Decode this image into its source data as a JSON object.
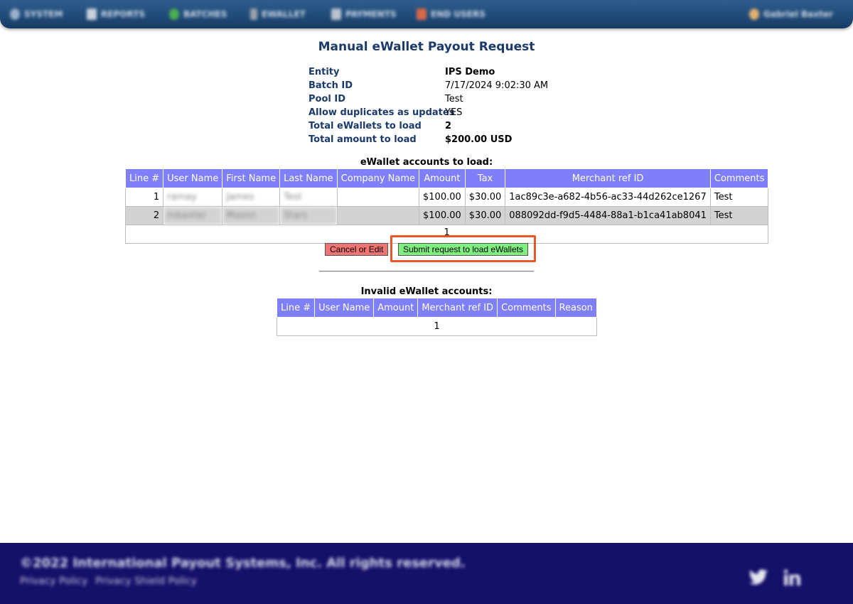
{
  "nav": {
    "items": [
      {
        "label": "SYSTEM",
        "icon": "gear-icon",
        "color": "#9ab0c8"
      },
      {
        "label": "REPORTS",
        "icon": "document-icon",
        "color": "#c8d2dc"
      },
      {
        "label": "BATCHES",
        "icon": "batches-icon",
        "color": "#4caf50"
      },
      {
        "label": "EWALLET",
        "icon": "wallet-icon",
        "color": "#9aa3ad"
      },
      {
        "label": "PAYMENTS",
        "icon": "payments-icon",
        "color": "#b9c3cf"
      },
      {
        "label": "END USERS",
        "icon": "users-icon",
        "color": "#d66a4a"
      }
    ],
    "user_label": "Gabriel Baxter"
  },
  "title": "Manual eWallet Payout Request",
  "info": [
    {
      "label": "Entity",
      "value": "IPS Demo",
      "bold": true
    },
    {
      "label": "Batch ID",
      "value": "7/17/2024 9:02:30 AM",
      "bold": false
    },
    {
      "label": "Pool ID",
      "value": "Test",
      "bold": false
    },
    {
      "label": "Allow duplicates as updates",
      "value": "YES",
      "bold": false
    },
    {
      "label": "Total eWallets to load",
      "value": "2",
      "bold": true
    },
    {
      "label": "Total amount to load",
      "value": "$200.00 USD",
      "bold": true
    }
  ],
  "load_table": {
    "title": "eWallet accounts to load:",
    "headers": [
      "Line #",
      "User Name",
      "First Name",
      "Last Name",
      "Company Name",
      "Amount",
      "Tax",
      "Merchant ref ID",
      "Comments"
    ],
    "rows": [
      {
        "line": "1",
        "user": "ramay",
        "first": "James",
        "last": "Test",
        "company": "",
        "amount": "$100.00",
        "tax": "$30.00",
        "ref": "1ac89c3e-a682-4b56-ac33-44d262ce1267",
        "comments": "Test"
      },
      {
        "line": "2",
        "user": "mbaxter",
        "first": "Mason",
        "last": "Stars",
        "company": "",
        "amount": "$100.00",
        "tax": "$30.00",
        "ref": "088092dd-f9d5-4484-88a1-b1ca41ab8041",
        "comments": "Test"
      }
    ],
    "pager": "1"
  },
  "buttons": {
    "cancel": "Cancel or Edit",
    "submit": "Submit request to load eWallets"
  },
  "invalid_table": {
    "title": "Invalid eWallet accounts:",
    "headers": [
      "Line #",
      "User Name",
      "Amount",
      "Merchant ref ID",
      "Comments",
      "Reason"
    ],
    "pager": "1"
  },
  "footer": {
    "copyright": "©2022 International Payout Systems, Inc. All rights reserved.",
    "links": [
      "Privacy Policy",
      "Privacy Shield Policy"
    ]
  },
  "colors": {
    "header_bg": "#7f7ff9",
    "title": "#1a3a6b",
    "cancel_bg": "#f07474",
    "submit_bg": "#7ff07f",
    "highlight": "#e8572a",
    "footer_bg": "#15106a"
  }
}
